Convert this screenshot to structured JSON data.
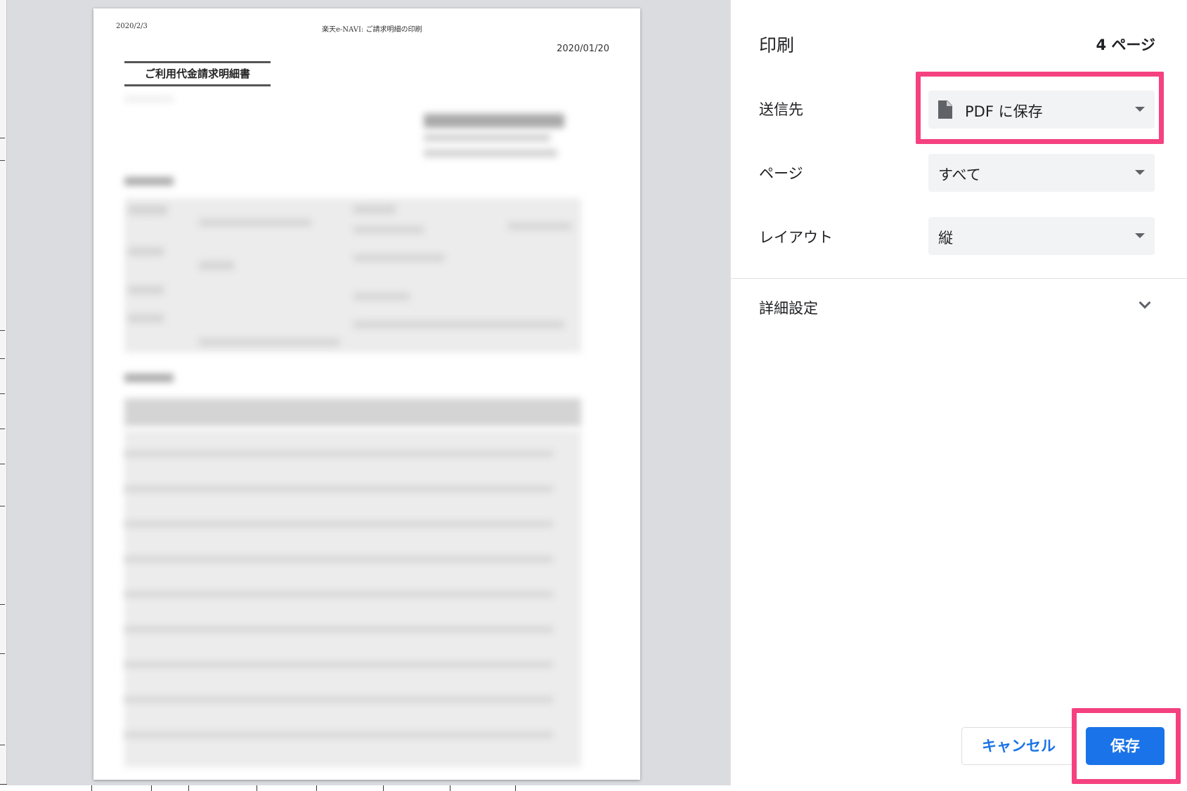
{
  "preview": {
    "header_left": "2020/2/3",
    "header_center": "楽天e-NAVI: ご請求明細の印刷",
    "date": "2020/01/20",
    "doc_title": "ご利用代金請求明細書"
  },
  "settings": {
    "title": "印刷",
    "page_count": "4 ページ",
    "destination": {
      "label": "送信先",
      "value": "PDF に保存"
    },
    "pages": {
      "label": "ページ",
      "value": "すべて"
    },
    "layout": {
      "label": "レイアウト",
      "value": "縦"
    },
    "more_settings": "詳細設定"
  },
  "buttons": {
    "cancel": "キャンセル",
    "save": "保存"
  },
  "colors": {
    "accent": "#1a73e8",
    "highlight": "#f5417f"
  }
}
